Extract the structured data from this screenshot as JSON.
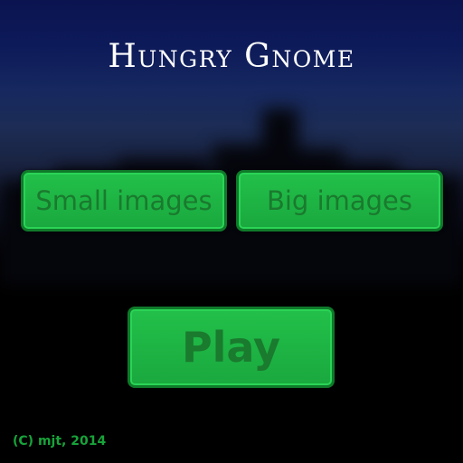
{
  "game": {
    "title": "Hungry Gnome",
    "copyright": "(C) mjt, 2014"
  },
  "menu": {
    "small_images_label": "Small images",
    "big_images_label": "Big images",
    "play_label": "Play"
  },
  "colors": {
    "button_green": "#1fb545",
    "button_text": "#1a7a2e",
    "copyright_text": "#17a33a",
    "sky_top": "#0b144f"
  }
}
